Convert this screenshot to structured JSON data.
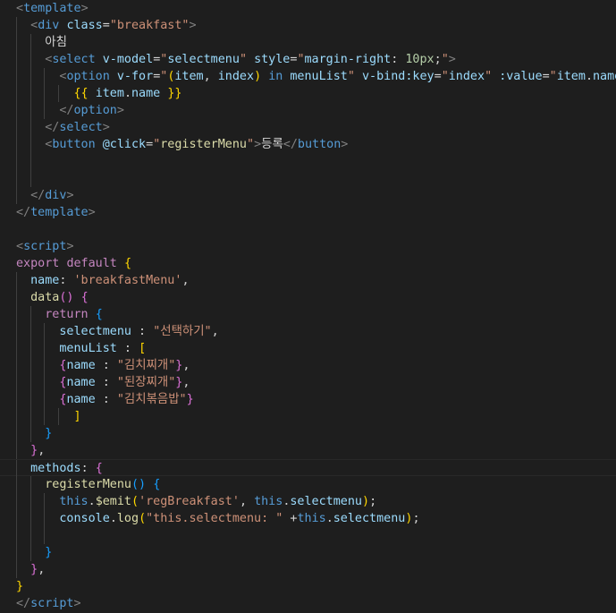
{
  "lines": [
    [
      [
        "brk",
        "<"
      ],
      [
        "tag",
        "template"
      ],
      [
        "brk",
        ">"
      ]
    ],
    [
      [
        "txt",
        "  "
      ],
      [
        "brk",
        "<"
      ],
      [
        "tag",
        "div"
      ],
      [
        "txt",
        " "
      ],
      [
        "attr",
        "class"
      ],
      [
        "txt",
        "="
      ],
      [
        "str",
        "\"breakfast\""
      ],
      [
        "brk",
        ">"
      ]
    ],
    [
      [
        "txt",
        "    아침"
      ]
    ],
    [
      [
        "txt",
        "    "
      ],
      [
        "brk",
        "<"
      ],
      [
        "tag",
        "select"
      ],
      [
        "txt",
        " "
      ],
      [
        "attr",
        "v-model"
      ],
      [
        "txt",
        "="
      ],
      [
        "str",
        "\""
      ],
      [
        "var",
        "selectmenu"
      ],
      [
        "str",
        "\""
      ],
      [
        "txt",
        " "
      ],
      [
        "attr",
        "style"
      ],
      [
        "txt",
        "="
      ],
      [
        "str",
        "\""
      ],
      [
        "var",
        "margin-right"
      ],
      [
        "txt",
        ": "
      ],
      [
        "num",
        "10px"
      ],
      [
        "txt",
        ";"
      ],
      [
        "str",
        "\""
      ],
      [
        "brk",
        ">"
      ]
    ],
    [
      [
        "txt",
        "      "
      ],
      [
        "brk",
        "<"
      ],
      [
        "tag",
        "option"
      ],
      [
        "txt",
        " "
      ],
      [
        "attr",
        "v-for"
      ],
      [
        "txt",
        "="
      ],
      [
        "str",
        "\""
      ],
      [
        "p1",
        "("
      ],
      [
        "var",
        "item"
      ],
      [
        "txt",
        ", "
      ],
      [
        "var",
        "index"
      ],
      [
        "p1",
        ")"
      ],
      [
        "txt",
        " "
      ],
      [
        "kw",
        "in"
      ],
      [
        "txt",
        " "
      ],
      [
        "var",
        "menuList"
      ],
      [
        "str",
        "\""
      ],
      [
        "txt",
        " "
      ],
      [
        "attr",
        "v-bind:key"
      ],
      [
        "txt",
        "="
      ],
      [
        "str",
        "\""
      ],
      [
        "var",
        "index"
      ],
      [
        "str",
        "\""
      ],
      [
        "txt",
        " "
      ],
      [
        "attr",
        ":value"
      ],
      [
        "txt",
        "="
      ],
      [
        "str",
        "\""
      ],
      [
        "var",
        "item"
      ],
      [
        "txt",
        "."
      ],
      [
        "var",
        "name"
      ],
      [
        "str",
        "\""
      ],
      [
        "brk",
        ">"
      ]
    ],
    [
      [
        "txt",
        "        "
      ],
      [
        "p1",
        "{{"
      ],
      [
        "txt",
        " "
      ],
      [
        "var",
        "item"
      ],
      [
        "txt",
        "."
      ],
      [
        "var",
        "name"
      ],
      [
        "txt",
        " "
      ],
      [
        "p1",
        "}}"
      ]
    ],
    [
      [
        "txt",
        "      "
      ],
      [
        "brk",
        "</"
      ],
      [
        "tag",
        "option"
      ],
      [
        "brk",
        ">"
      ]
    ],
    [
      [
        "txt",
        "    "
      ],
      [
        "brk",
        "</"
      ],
      [
        "tag",
        "select"
      ],
      [
        "brk",
        ">"
      ]
    ],
    [
      [
        "txt",
        "    "
      ],
      [
        "brk",
        "<"
      ],
      [
        "tag",
        "button"
      ],
      [
        "txt",
        " "
      ],
      [
        "attr",
        "@click"
      ],
      [
        "txt",
        "="
      ],
      [
        "str",
        "\""
      ],
      [
        "fn",
        "registerMenu"
      ],
      [
        "str",
        "\""
      ],
      [
        "brk",
        ">"
      ],
      [
        "txt",
        "등록"
      ],
      [
        "brk",
        "</"
      ],
      [
        "tag",
        "button"
      ],
      [
        "brk",
        ">"
      ]
    ],
    [],
    [],
    [
      [
        "txt",
        "  "
      ],
      [
        "brk",
        "</"
      ],
      [
        "tag",
        "div"
      ],
      [
        "brk",
        ">"
      ]
    ],
    [
      [
        "brk",
        "</"
      ],
      [
        "tag",
        "template"
      ],
      [
        "brk",
        ">"
      ]
    ],
    [],
    [
      [
        "brk",
        "<"
      ],
      [
        "tag",
        "script"
      ],
      [
        "brk",
        ">"
      ]
    ],
    [
      [
        "ctl",
        "export"
      ],
      [
        "txt",
        " "
      ],
      [
        "ctl",
        "default"
      ],
      [
        "txt",
        " "
      ],
      [
        "p1",
        "{"
      ]
    ],
    [
      [
        "txt",
        "  "
      ],
      [
        "var",
        "name"
      ],
      [
        "txt",
        ": "
      ],
      [
        "str",
        "'breakfastMenu'"
      ],
      [
        "txt",
        ","
      ]
    ],
    [
      [
        "txt",
        "  "
      ],
      [
        "fn",
        "data"
      ],
      [
        "p2",
        "()"
      ],
      [
        "txt",
        " "
      ],
      [
        "p2",
        "{"
      ]
    ],
    [
      [
        "txt",
        "    "
      ],
      [
        "ctl",
        "return"
      ],
      [
        "txt",
        " "
      ],
      [
        "p3",
        "{"
      ]
    ],
    [
      [
        "txt",
        "      "
      ],
      [
        "var",
        "selectmenu"
      ],
      [
        "txt",
        " : "
      ],
      [
        "str",
        "\"선택하기\""
      ],
      [
        "txt",
        ","
      ]
    ],
    [
      [
        "txt",
        "      "
      ],
      [
        "var",
        "menuList"
      ],
      [
        "txt",
        " : "
      ],
      [
        "p1",
        "["
      ]
    ],
    [
      [
        "txt",
        "      "
      ],
      [
        "p2",
        "{"
      ],
      [
        "var",
        "name"
      ],
      [
        "txt",
        " : "
      ],
      [
        "str",
        "\"김치찌개\""
      ],
      [
        "p2",
        "}"
      ],
      [
        "txt",
        ","
      ]
    ],
    [
      [
        "txt",
        "      "
      ],
      [
        "p2",
        "{"
      ],
      [
        "var",
        "name"
      ],
      [
        "txt",
        " : "
      ],
      [
        "str",
        "\"된장찌개\""
      ],
      [
        "p2",
        "}"
      ],
      [
        "txt",
        ","
      ]
    ],
    [
      [
        "txt",
        "      "
      ],
      [
        "p2",
        "{"
      ],
      [
        "var",
        "name"
      ],
      [
        "txt",
        " : "
      ],
      [
        "str",
        "\"김치볶음밥\""
      ],
      [
        "p2",
        "}"
      ]
    ],
    [
      [
        "txt",
        "        "
      ],
      [
        "p1",
        "]"
      ]
    ],
    [
      [
        "txt",
        "    "
      ],
      [
        "p3",
        "}"
      ]
    ],
    [
      [
        "txt",
        "  "
      ],
      [
        "p2",
        "}"
      ],
      [
        "txt",
        ","
      ]
    ],
    [
      [
        "txt",
        "  "
      ],
      [
        "var",
        "methods"
      ],
      [
        "txt",
        ": "
      ],
      [
        "p2",
        "{"
      ]
    ],
    [
      [
        "txt",
        "    "
      ],
      [
        "fn",
        "registerMenu"
      ],
      [
        "p3",
        "()"
      ],
      [
        "txt",
        " "
      ],
      [
        "p3",
        "{"
      ]
    ],
    [
      [
        "txt",
        "      "
      ],
      [
        "kw",
        "this"
      ],
      [
        "txt",
        "."
      ],
      [
        "fn",
        "$emit"
      ],
      [
        "p1",
        "("
      ],
      [
        "str",
        "'regBreakfast'"
      ],
      [
        "txt",
        ", "
      ],
      [
        "kw",
        "this"
      ],
      [
        "txt",
        "."
      ],
      [
        "var",
        "selectmenu"
      ],
      [
        "p1",
        ")"
      ],
      [
        "txt",
        ";"
      ]
    ],
    [
      [
        "txt",
        "      "
      ],
      [
        "var",
        "console"
      ],
      [
        "txt",
        "."
      ],
      [
        "fn",
        "log"
      ],
      [
        "p1",
        "("
      ],
      [
        "str",
        "\"this.selectmenu: \""
      ],
      [
        "txt",
        " +"
      ],
      [
        "kw",
        "this"
      ],
      [
        "txt",
        "."
      ],
      [
        "var",
        "selectmenu"
      ],
      [
        "p1",
        ")"
      ],
      [
        "txt",
        ";"
      ]
    ],
    [],
    [
      [
        "txt",
        "    "
      ],
      [
        "p3",
        "}"
      ]
    ],
    [
      [
        "txt",
        "  "
      ],
      [
        "p2",
        "}"
      ],
      [
        "txt",
        ","
      ]
    ],
    [
      [
        "p1",
        "}"
      ]
    ],
    [
      [
        "brk",
        "</"
      ],
      [
        "tag",
        "script"
      ],
      [
        "brk",
        ">"
      ]
    ]
  ],
  "guides": [
    [],
    [
      0
    ],
    [
      0,
      1
    ],
    [
      0,
      1
    ],
    [
      0,
      1,
      2
    ],
    [
      0,
      1,
      2,
      3
    ],
    [
      0,
      1,
      2
    ],
    [
      0,
      1
    ],
    [
      0,
      1
    ],
    [
      0,
      1
    ],
    [
      0,
      1
    ],
    [
      0
    ],
    [],
    [],
    [],
    [],
    [
      0
    ],
    [
      0
    ],
    [
      0,
      1
    ],
    [
      0,
      1,
      2
    ],
    [
      0,
      1,
      2
    ],
    [
      0,
      1,
      2
    ],
    [
      0,
      1,
      2
    ],
    [
      0,
      1,
      2
    ],
    [
      0,
      1,
      2,
      3
    ],
    [
      0,
      1
    ],
    [
      0
    ],
    [
      0
    ],
    [
      0,
      1
    ],
    [
      0,
      1,
      2
    ],
    [
      0,
      1,
      2
    ],
    [
      0,
      1,
      2
    ],
    [
      0,
      1
    ],
    [
      0
    ],
    [],
    []
  ],
  "current_line": 27
}
